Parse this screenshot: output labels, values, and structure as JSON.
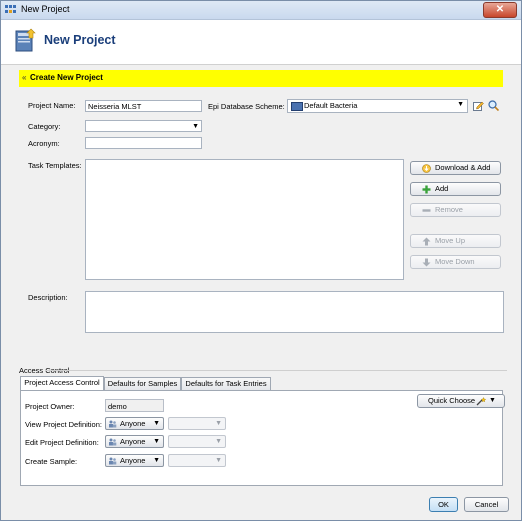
{
  "window": {
    "title": "New Project",
    "close_glyph": "✕"
  },
  "header": {
    "title": "New Project",
    "icon": "project-icon"
  },
  "banner": {
    "chevron": "«",
    "title": "Create New Project"
  },
  "form": {
    "project_name_label": "Project Name:",
    "project_name_value": "Neisseria MLST",
    "epi_scheme_label": "Epi Database Scheme:",
    "epi_scheme_value": "Default Bacteria",
    "category_label": "Category:",
    "category_value": "",
    "acronym_label": "Acronym:",
    "acronym_value": "",
    "task_templates_label": "Task Templates:",
    "description_label": "Description:",
    "description_value": ""
  },
  "task_buttons": {
    "download_add": "Download & Add",
    "add": "Add",
    "remove": "Remove",
    "move_up": "Move Up",
    "move_down": "Move Down"
  },
  "access_control": {
    "section_label": "Access Control",
    "tabs": [
      "Project Access Control",
      "Defaults for Samples",
      "Defaults for Task Entries"
    ],
    "active_tab": 0,
    "project_owner_label": "Project Owner:",
    "project_owner_value": "demo",
    "quick_choose": "Quick Choose",
    "rows": [
      {
        "label": "View Project Definition:",
        "value": "Anyone"
      },
      {
        "label": "Edit Project Definition:",
        "value": "Anyone"
      },
      {
        "label": "Create Sample:",
        "value": "Anyone"
      }
    ]
  },
  "footer": {
    "ok": "OK",
    "cancel": "Cancel"
  },
  "colors": {
    "banner": "#ffff00",
    "header_title": "#1a3e7a",
    "close": "#c7452b"
  }
}
